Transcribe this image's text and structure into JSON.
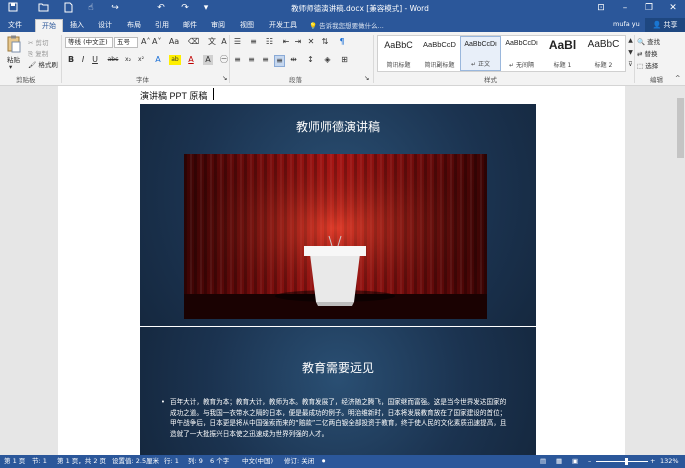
{
  "window": {
    "title": "教师师德演讲稿.docx [兼容模式] - Word",
    "minimize": "–",
    "restore": "❐",
    "close": "✕",
    "ribbon_toggle": "⊡"
  },
  "quick_access": {
    "save_icon": "save-icon",
    "open_icon": "folder-icon",
    "new_icon": "new-doc-icon",
    "undo_icon": "undo-icon",
    "redo_icon": "redo-icon"
  },
  "tabs": [
    {
      "label": "文件"
    },
    {
      "label": "开始"
    },
    {
      "label": "插入"
    },
    {
      "label": "设计"
    },
    {
      "label": "布局"
    },
    {
      "label": "引用"
    },
    {
      "label": "邮件"
    },
    {
      "label": "审阅"
    },
    {
      "label": "视图"
    },
    {
      "label": "开发工具"
    }
  ],
  "tell_me": "告诉我您想要做什么...",
  "user_name": "mufa yu",
  "share_label": "共享",
  "clipboard": {
    "paste": "粘贴",
    "cut": "剪切",
    "copy": "复制",
    "format_painter": "格式刷",
    "group_label": "剪贴板"
  },
  "font": {
    "family": "等线 (中文正)",
    "size": "五号",
    "group_label": "字体",
    "bold": "B",
    "italic": "I",
    "underline": "U",
    "strike": "abc",
    "subscript": "x₂",
    "superscript": "x²",
    "grow": "A˄",
    "shrink": "A˅",
    "change_case": "Aa",
    "font_color": "A",
    "highlight": "ab"
  },
  "paragraph": {
    "group_label": "段落"
  },
  "styles": {
    "group_label": "样式",
    "items": [
      {
        "sample": "AaBbC",
        "name": "简讯标题"
      },
      {
        "sample": "AaBbCcD",
        "name": "简讯副标题"
      },
      {
        "sample": "AaBbCcDi",
        "name": "↵ 正文"
      },
      {
        "sample": "AaBbCcDi",
        "name": "↵ 无间隔"
      },
      {
        "sample": "AaBl",
        "name": "标题 1"
      },
      {
        "sample": "AaBbC",
        "name": "标题 2"
      }
    ]
  },
  "editing": {
    "find": "查找",
    "replace": "替换",
    "select": "选择",
    "group_label": "编辑"
  },
  "document": {
    "heading": "演讲稿 PPT 原稿",
    "slide1_title": "教师师德演讲稿",
    "slide2_title": "教育需要远见",
    "bullet": "•",
    "slide2_body": "百年大计，教育为本；教育大计，教师为本。教育发展了，经济随之腾飞，国家继而富强。这是当今世界发达国家的成功之道。与我国一衣带水之隔的日本，便是最成功的例子。明治维新时，日本将发展教育放在了国家建设的首位；甲午战争后，日本更是将从中国强索而来的“赔款”二亿两白银全部投资于教育，终于使人民的文化素质迅速提高，且造就了一大批振兴日本使之迅速成为世界列强的人才。"
  },
  "statusbar": {
    "page": "第 1 页",
    "section": "节: 1",
    "pages": "第 1 页，共 2 页",
    "setting": "设置值: 2.5厘米",
    "line": "行: 1",
    "column": "列: 9",
    "chars": "6 个字",
    "language": "中文(中国)",
    "track": "修订: 关闭",
    "zoom": "132%"
  },
  "colors": {
    "accent": "#2b579a",
    "slide_bg": "#1f3a57",
    "curtain": "#a01010"
  }
}
